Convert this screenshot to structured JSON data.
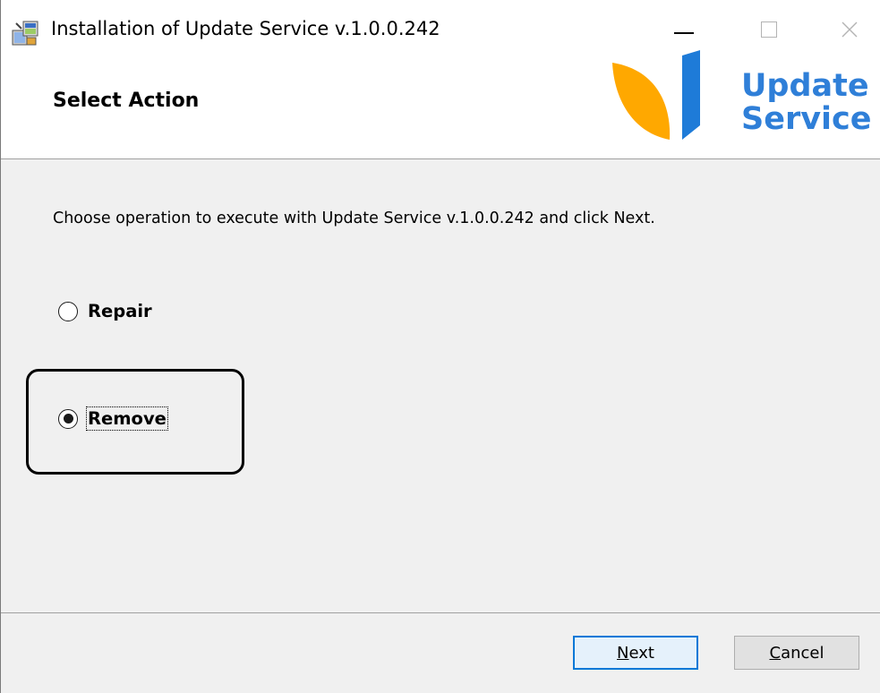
{
  "window": {
    "title": "Installation of Update Service v.1.0.0.242",
    "controls": {
      "minimize": "minimize",
      "maximize": "maximize",
      "close": "close"
    }
  },
  "header": {
    "title": "Select Action",
    "logo": {
      "line1": "Update",
      "line2": "Service",
      "colors": {
        "leaf": "#ffa800",
        "bar": "#1e7bd8",
        "text": "#2f7fd8"
      }
    }
  },
  "content": {
    "instructions": "Choose operation to execute with Update Service v.1.0.0.242 and click Next.",
    "options": [
      {
        "label": "Repair",
        "selected": false
      },
      {
        "label": "Remove",
        "selected": true
      }
    ]
  },
  "footer": {
    "next": {
      "accel": "N",
      "rest": "ext"
    },
    "cancel": {
      "accel": "C",
      "rest": "ancel"
    }
  },
  "colors": {
    "focus_border": "#0078d7",
    "background": "#f0f0f0"
  }
}
